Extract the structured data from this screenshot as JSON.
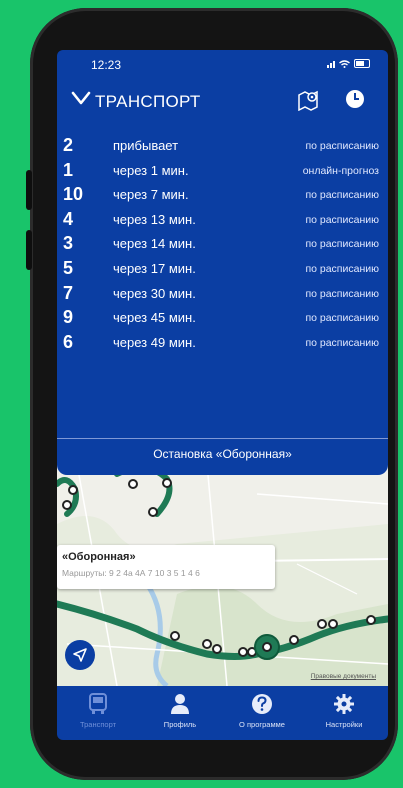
{
  "status": {
    "time": "12:23"
  },
  "header": {
    "title": "ТРАНСПОРТ",
    "back_icon": "chevron-down-icon",
    "map_icon": "map-pin-icon",
    "history_icon": "clock-icon"
  },
  "arrivals": [
    {
      "route": "2",
      "when": "прибывает",
      "source": "по расписанию"
    },
    {
      "route": "1",
      "when": "через 1 мин.",
      "source": "онлайн-прогноз"
    },
    {
      "route": "10",
      "when": "через 7 мин.",
      "source": "по расписанию"
    },
    {
      "route": "4",
      "when": "через 13 мин.",
      "source": "по расписанию"
    },
    {
      "route": "3",
      "when": "через 14 мин.",
      "source": "по расписанию"
    },
    {
      "route": "5",
      "when": "через 17 мин.",
      "source": "по расписанию"
    },
    {
      "route": "7",
      "when": "через 30 мин.",
      "source": "по расписанию"
    },
    {
      "route": "9",
      "when": "через 45 мин.",
      "source": "по расписанию"
    },
    {
      "route": "6",
      "when": "через 49 мин.",
      "source": "по расписанию"
    }
  ],
  "stop_bar": {
    "label": "Остановка «Оборонная»"
  },
  "map": {
    "popup_title": "«Оборонная»",
    "popup_routes": "Маршруты: 9 2 4а 4А 7 10 3 5 1 4 6",
    "legal_link": "Правовые документы",
    "route_color": "#1f7a55"
  },
  "tabs": [
    {
      "label": "Транспорт",
      "icon": "bus-icon",
      "active": true
    },
    {
      "label": "Профиль",
      "icon": "person-icon",
      "active": false
    },
    {
      "label": "О программе",
      "icon": "question-icon",
      "active": false
    },
    {
      "label": "Настройки",
      "icon": "gear-icon",
      "active": false
    }
  ],
  "colors": {
    "background": "#19c46a",
    "panel": "#0b3ea3"
  }
}
